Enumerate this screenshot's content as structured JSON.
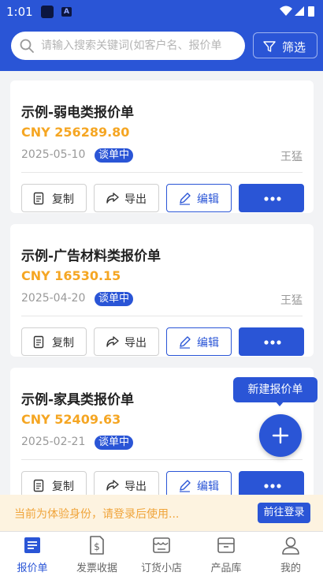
{
  "status_bar": {
    "time": "1:01",
    "app_icon_letter": "A"
  },
  "search": {
    "placeholder": "请输入搜索关键词(如客户名、报价单"
  },
  "filter": {
    "label": "筛选"
  },
  "actions": {
    "copy": "复制",
    "export": "导出",
    "edit": "编辑"
  },
  "quotes": [
    {
      "title": "示例-弱电类报价单",
      "amount": "CNY 256289.80",
      "date": "2025-05-10",
      "status": "谈单中",
      "owner": "王猛"
    },
    {
      "title": "示例-广告材料类报价单",
      "amount": "CNY 16530.15",
      "date": "2025-04-20",
      "status": "谈单中",
      "owner": "王猛"
    },
    {
      "title": "示例-家具类报价单",
      "amount": "CNY 52409.63",
      "date": "2025-02-21",
      "status": "谈单中",
      "owner": ""
    }
  ],
  "fab": {
    "tooltip": "新建报价单"
  },
  "notice": {
    "text": "当前为体验身份，请登录后使用...",
    "login_label": "前往登录"
  },
  "tabs": [
    {
      "label": "报价单",
      "icon": "quote-doc-icon",
      "active": true
    },
    {
      "label": "发票收据",
      "icon": "invoice-icon",
      "active": false
    },
    {
      "label": "订货小店",
      "icon": "store-icon",
      "active": false
    },
    {
      "label": "产品库",
      "icon": "product-box-icon",
      "active": false
    },
    {
      "label": "我的",
      "icon": "user-icon",
      "active": false
    }
  ],
  "colors": {
    "primary": "#2a55d6",
    "amount": "#f5a623",
    "notice_bg": "#fdf3e0",
    "notice_text": "#f0a43a"
  }
}
